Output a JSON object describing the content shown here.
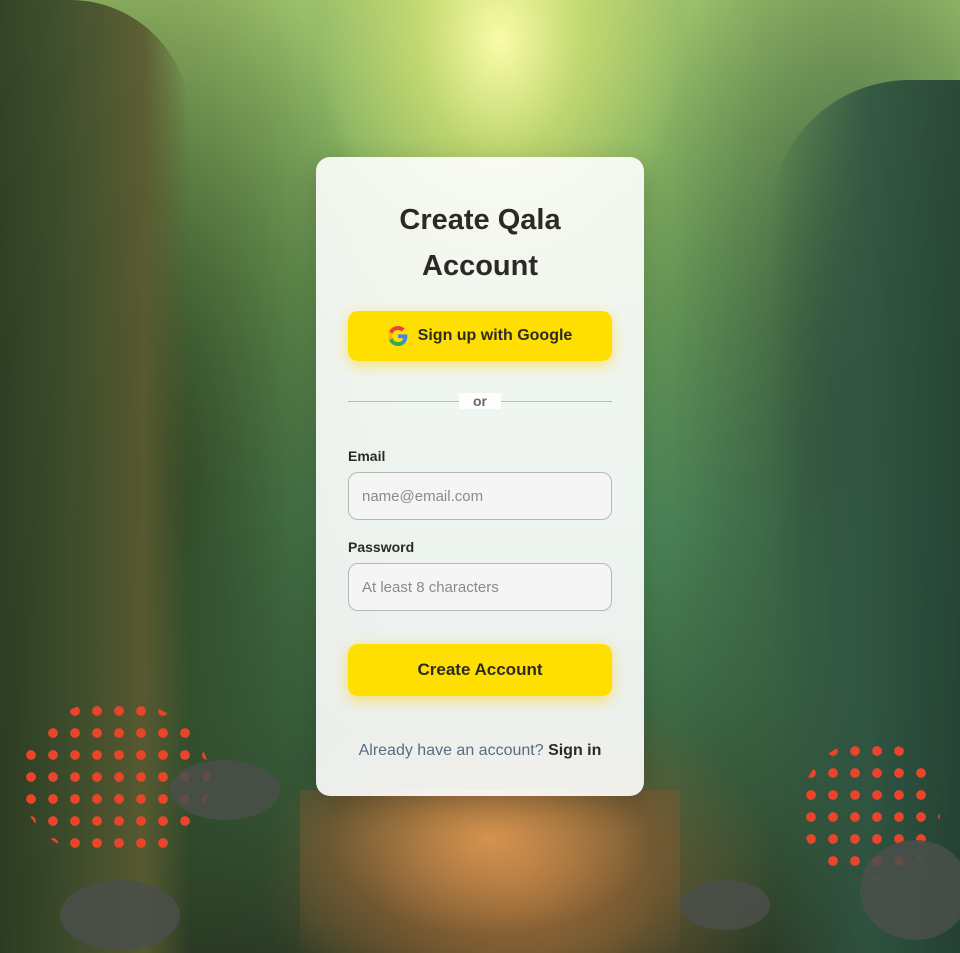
{
  "form": {
    "title": "Create Qala Account",
    "google_button_label": "Sign up with Google",
    "divider_text": "or",
    "email_label": "Email",
    "email_placeholder": "name@email.com",
    "email_value": "",
    "password_label": "Password",
    "password_placeholder": "At least 8 characters",
    "password_value": "",
    "submit_label": "Create Account",
    "signin_prompt": "Already have an account?",
    "signin_link": "Sign in"
  },
  "icons": {
    "google": "google-g-icon"
  },
  "colors": {
    "accent": "#ffdf00",
    "text": "#2d2a26",
    "muted": "#5a6b80"
  }
}
